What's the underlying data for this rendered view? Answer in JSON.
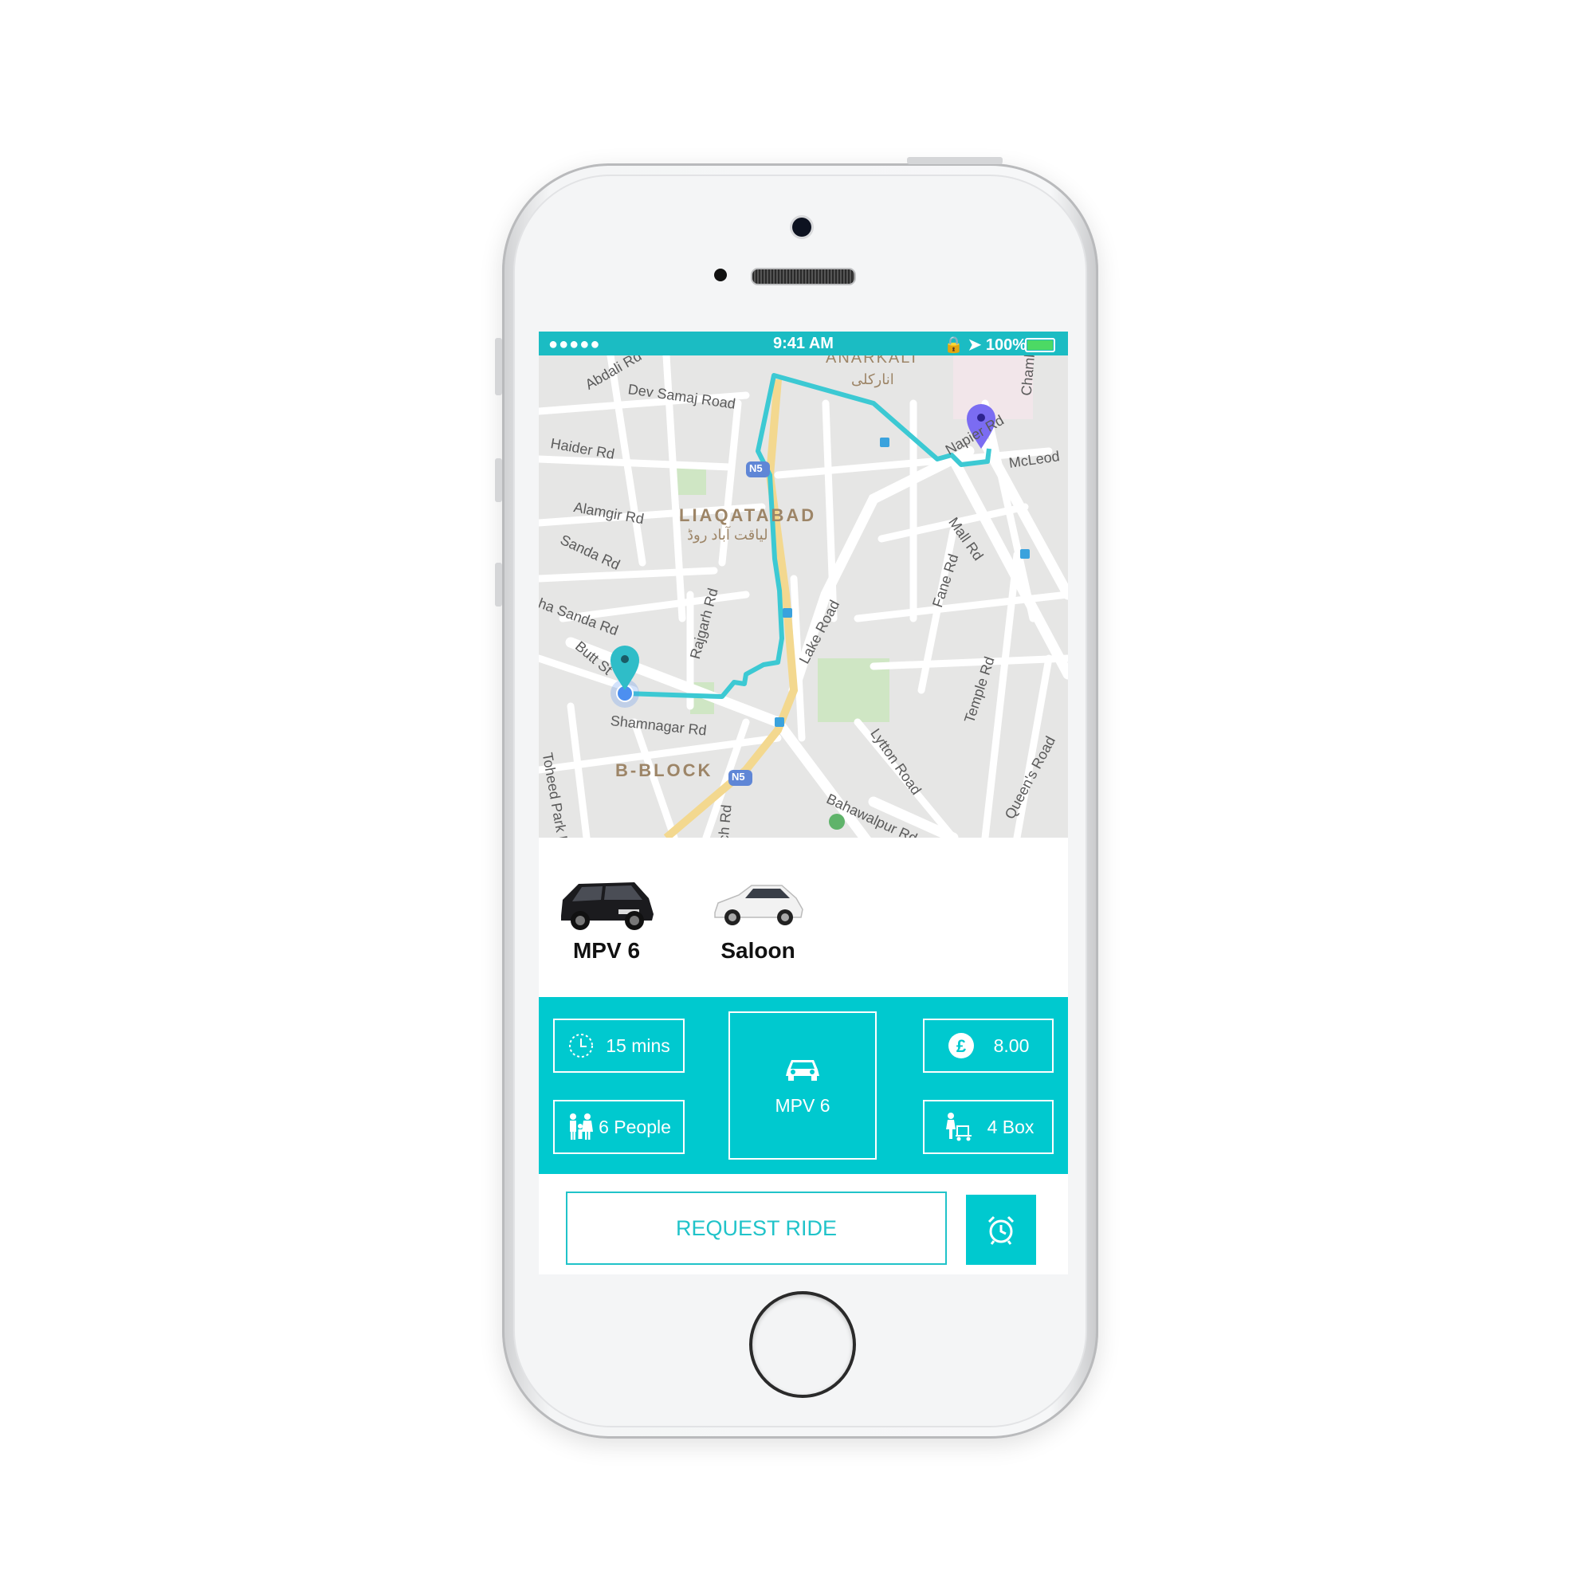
{
  "status_bar": {
    "signal": "●●●●● ",
    "wifi": "wifi-icon",
    "time": "9:41 AM",
    "right": "🔒 ➤ 100%",
    "battery": "battery-icon"
  },
  "map": {
    "labels": [
      "Abdali Rd",
      "Dev Samaj Road",
      "Haider Rd",
      "Alamgir Rd",
      "Sanda Rd",
      "ha Sanda Rd",
      "Butt St",
      "Rajgarh Rd",
      "Shamnagar Rd",
      "Toheed Park Ro",
      "Lake Road",
      "Lytton Road",
      "Bahawalpur Rd",
      "Fane Rd",
      "Mall Rd",
      "McLeod",
      "Napier Rd",
      "Temple Rd",
      "Queen's Road",
      "Chamb",
      "ch Rd",
      "ANARKALI",
      "انارکلی",
      "N5",
      "N5"
    ],
    "districts": [
      "LIAQATABAD",
      "لیاقت آباد روڈ",
      "B-BLOCK"
    ],
    "route_color": "#3cc9d3",
    "origin_pin_color": "#2fbdc8",
    "destination_pin_color": "#7b6cf2"
  },
  "vehicles": [
    {
      "name": "MPV 6",
      "image": "black-mpv-car"
    },
    {
      "name": "Saloon",
      "image": "white-saloon-car"
    }
  ],
  "details": {
    "eta": "15 mins",
    "eta_icon": "clock-icon",
    "people": "6 People",
    "people_icon": "family-icon",
    "selected_vehicle": "MPV 6",
    "vehicle_icon": "car-icon",
    "price": "8.00",
    "price_icon": "pound-icon",
    "luggage": "4 Box",
    "luggage_icon": "luggage-icon"
  },
  "actions": {
    "request_label": "REQUEST RIDE",
    "alarm_icon": "alarm-clock-icon"
  },
  "colors": {
    "accent": "#00c9cf",
    "status_bar": "#1bbcc3"
  }
}
